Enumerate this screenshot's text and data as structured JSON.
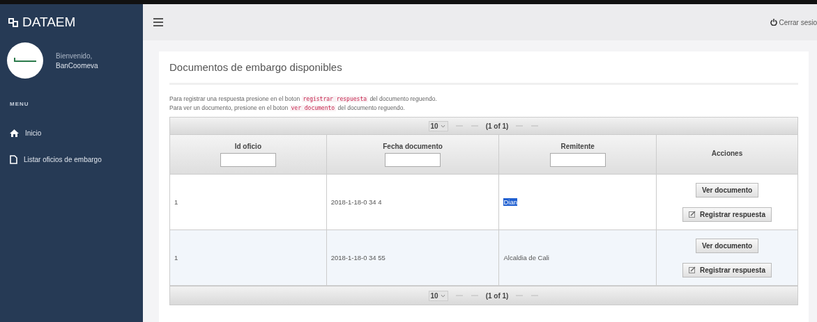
{
  "brand": "DATAEM",
  "user": {
    "greeting": "Bienvenido,",
    "name": "BanCoomeva"
  },
  "menu": {
    "heading": "MENU",
    "items": [
      {
        "label": "Inicio",
        "kind": "home"
      },
      {
        "label": "Listar oficios de embargo",
        "kind": "document"
      }
    ]
  },
  "topbar": {
    "logout": "Cerrar sesio"
  },
  "panel": {
    "title": "Documentos de embargo disponibles",
    "instructions": [
      [
        {
          "kind": "text",
          "text": "Para registrar una respuesta presione en el boton"
        },
        {
          "kind": "code",
          "text": "registrar respuesta"
        },
        {
          "kind": "text",
          "text": "del documento reguendo."
        }
      ],
      [
        {
          "kind": "text",
          "text": "Para ver un documento, presione en el boton"
        },
        {
          "kind": "code",
          "text": "ver documento"
        },
        {
          "kind": "text",
          "text": "del documento reguendo."
        }
      ]
    ]
  },
  "pager_top": {
    "rows_per_page": "10",
    "page": "(1 of 1)"
  },
  "table": {
    "columns": [
      {
        "label": "Id oficio",
        "filter": true
      },
      {
        "label": "Fecha documento",
        "filter": true
      },
      {
        "label": "Remitente",
        "filter": true
      },
      {
        "label": "Acciones",
        "filter": false
      }
    ],
    "rows": [
      {
        "id": "1",
        "fecha": "2018-1-18-0 34 4",
        "remitente": "Dian",
        "remitente_highlighted": true,
        "buttons": [
          "Ver documento",
          "Registrar respuesta"
        ]
      },
      {
        "id": "1",
        "fecha": "2018-1-18-0 34 55",
        "remitente": "Alcaldia de Cali",
        "remitente_highlighted": false,
        "buttons": [
          "Ver documento",
          "Registrar respuesta"
        ]
      }
    ]
  },
  "pager_bottom": {
    "rows_per_page": "10",
    "page": "(1 of 1)"
  }
}
